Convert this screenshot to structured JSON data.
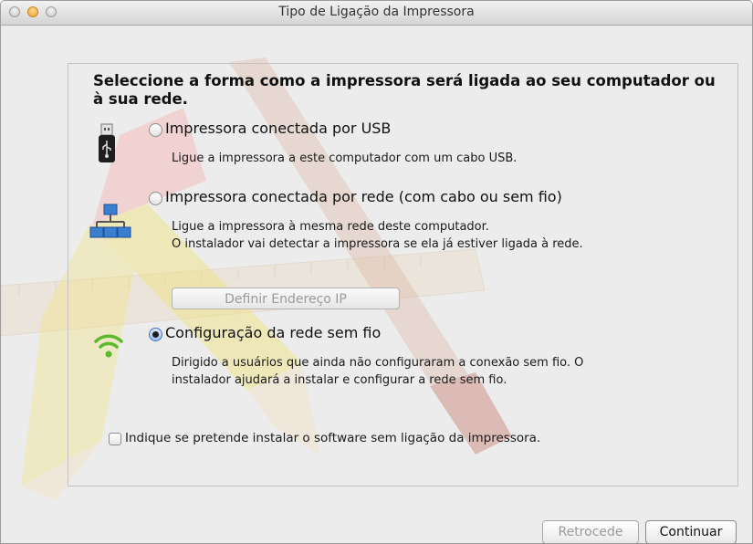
{
  "window": {
    "title": "Tipo de Ligação da Impressora"
  },
  "main": {
    "heading": "Seleccione a forma como a impressora será ligada ao seu computador ou à sua rede.",
    "options": [
      {
        "label": "Impressora conectada por USB",
        "description_lines": [
          "Ligue a impressora a este computador com um cabo USB."
        ],
        "selected": false,
        "icon": "usb-icon"
      },
      {
        "label": "Impressora conectada por rede (com cabo ou sem fio)",
        "description_lines": [
          "Ligue a impressora à mesma rede deste computador.",
          "O instalador vai detectar a impressora se ela já estiver ligada à rede."
        ],
        "selected": false,
        "icon": "network-icon"
      },
      {
        "label": "Configuração da rede sem fio",
        "description_lines": [
          "Dirigido a usuários que ainda não configuraram a conexão sem fio. O",
          "instalador ajudará a instalar e configurar a rede sem fio."
        ],
        "selected": true,
        "icon": "wifi-icon"
      }
    ],
    "set_ip_button": "Definir Endereço IP",
    "no_printer_checkbox": {
      "label": "Indique se pretende instalar o software sem ligação da impressora.",
      "checked": false
    }
  },
  "footer": {
    "back_label": "Retrocede",
    "continue_label": "Continuar"
  },
  "colors": {
    "wifi_green": "#5cb82e",
    "network_blue": "#3a7ed0",
    "pencil_yellow": "#f1e27a"
  }
}
